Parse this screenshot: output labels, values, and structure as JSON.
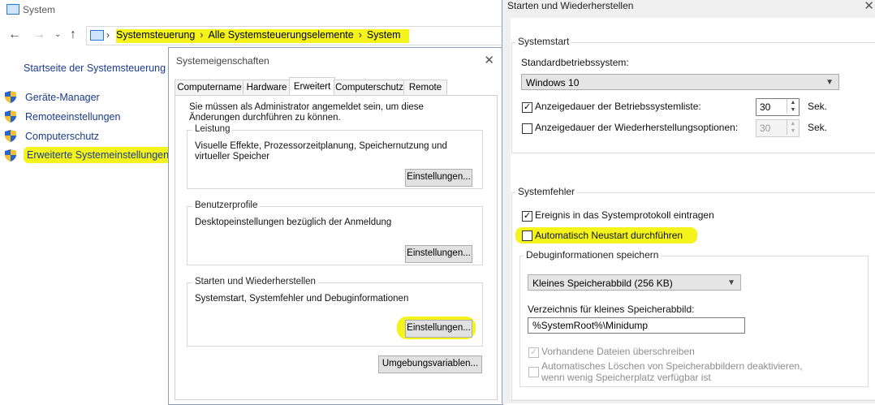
{
  "control_panel": {
    "window_title": "System",
    "breadcrumb": [
      "Systemsteuerung",
      "Alle Systemsteuerungselemente",
      "System"
    ],
    "sidebar_home": "Startseite der Systemsteuerung",
    "sidebar_items": [
      "Geräte-Manager",
      "Remoteeinstellungen",
      "Computerschutz",
      "Erweiterte Systemeinstellungen"
    ]
  },
  "system_properties": {
    "title": "Systemeigenschaften",
    "tabs": [
      "Computername",
      "Hardware",
      "Erweitert",
      "Computerschutz",
      "Remote"
    ],
    "active_tab": "Erweitert",
    "admin_note": "Sie müssen als Administrator angemeldet sein, um diese Änderungen durchführen zu können.",
    "performance": {
      "label": "Leistung",
      "desc": "Visuelle Effekte, Prozessorzeitplanung, Speichernutzung und virtueller Speicher",
      "button": "Einstellungen..."
    },
    "user_profiles": {
      "label": "Benutzerprofile",
      "desc": "Desktopeinstellungen bezüglich der Anmeldung",
      "button": "Einstellungen..."
    },
    "startup_recovery": {
      "label": "Starten und Wiederherstellen",
      "desc": "Systemstart, Systemfehler und Debuginformationen",
      "button": "Einstellungen..."
    },
    "env_button": "Umgebungsvariablen..."
  },
  "startup_recovery_dialog": {
    "title": "Starten und Wiederherstellen",
    "system_start": {
      "label": "Systemstart",
      "default_os_label": "Standardbetriebssystem:",
      "default_os_value": "Windows 10",
      "show_os_list_label": "Anzeigedauer der Betriebssystemliste:",
      "show_os_list_checked": true,
      "show_os_list_value": "30",
      "show_recovery_label": "Anzeigedauer der Wiederherstellungsoptionen:",
      "show_recovery_checked": false,
      "show_recovery_value": "30",
      "unit": "Sek."
    },
    "system_failure": {
      "label": "Systemfehler",
      "write_event_label": "Ereignis in das Systemprotokoll eintragen",
      "write_event_checked": true,
      "auto_restart_label": "Automatisch Neustart durchführen",
      "auto_restart_checked": false,
      "debug_group_label": "Debuginformationen speichern",
      "debug_type_value": "Kleines Speicherabbild (256 KB)",
      "dump_dir_label": "Verzeichnis für kleines Speicherabbild:",
      "dump_dir_value": "%SystemRoot%\\Minidump",
      "overwrite_label": "Vorhandene Dateien überschreiben",
      "overwrite_checked": true,
      "disable_auto_delete_label": "Automatisches Löschen von Speicherabbildern deaktivieren, wenn wenig Speicherplatz verfügbar ist",
      "disable_auto_delete_checked": false
    }
  },
  "colors": {
    "highlight": "#f4f41c",
    "link": "#1a3a8c"
  }
}
